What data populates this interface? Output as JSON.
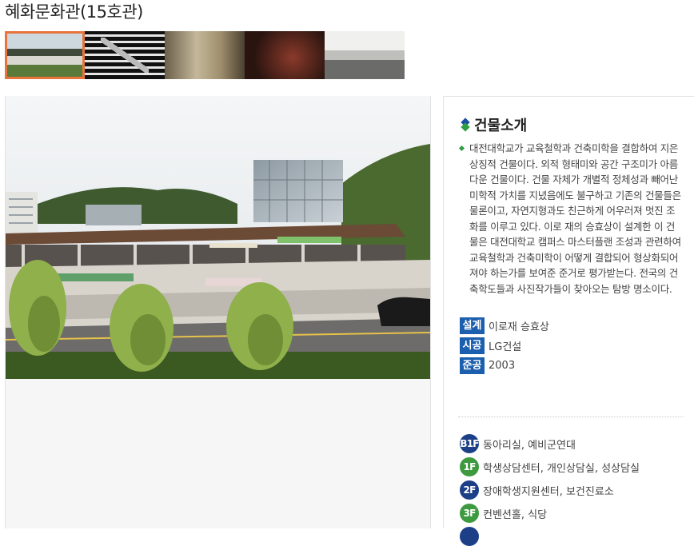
{
  "page": {
    "title": "혜화문화관(15호관)"
  },
  "thumbnails": [
    {
      "name": "building-exterior",
      "selected": true
    },
    {
      "name": "stair-pattern",
      "selected": false
    },
    {
      "name": "lobby-interior",
      "selected": false
    },
    {
      "name": "theater-interior",
      "selected": false
    },
    {
      "name": "hall-interior",
      "selected": false
    }
  ],
  "intro": {
    "heading": "건물소개",
    "description": "대전대학교가 교육철학과 건축미학을 결합하여 지은 상징적 건물이다. 외적 형태미와 공간 구조미가 아름다운 건물이다. 건물 자체가 개별적 정체성과 빼어난 미학적 가치를 지녔음에도 불구하고 기존의 건물들은 물론이고, 자연지형과도 친근하게 어우러져 멋진 조화를 이루고 있다. 이로 재의 승효상이 설계한 이 건물은 대전대학교 캠퍼스 마스터플랜 조성과 관련하여 교육철학과 건축미학이 어떻게 결합되어 형상화되어져야 하는가를 보여준 준거로 평가받는다. 전국의 건축학도들과 사진작가들이 찾아오는 탐방 명소이다."
  },
  "specs": [
    {
      "label": "설계",
      "value": "이로재 승효상"
    },
    {
      "label": "시공",
      "value": "LG건설"
    },
    {
      "label": "준공",
      "value": "2003"
    }
  ],
  "floors": [
    {
      "badge": "B1F",
      "color": "#1c3f87",
      "rooms": "동아리실, 예비군연대"
    },
    {
      "badge": "1F",
      "color": "#3d9a3f",
      "rooms": "학생상담센터, 개인상담실, 성상담실"
    },
    {
      "badge": "2F",
      "color": "#1c3f87",
      "rooms": "장애학생지원센터, 보건진료소"
    },
    {
      "badge": "3F",
      "color": "#3d9a3f",
      "rooms": "컨벤션홀, 식당"
    }
  ],
  "colors": {
    "accent_blue": "#1c5fae",
    "accent_green": "#2f9e44",
    "selected_border": "#e8743b"
  }
}
